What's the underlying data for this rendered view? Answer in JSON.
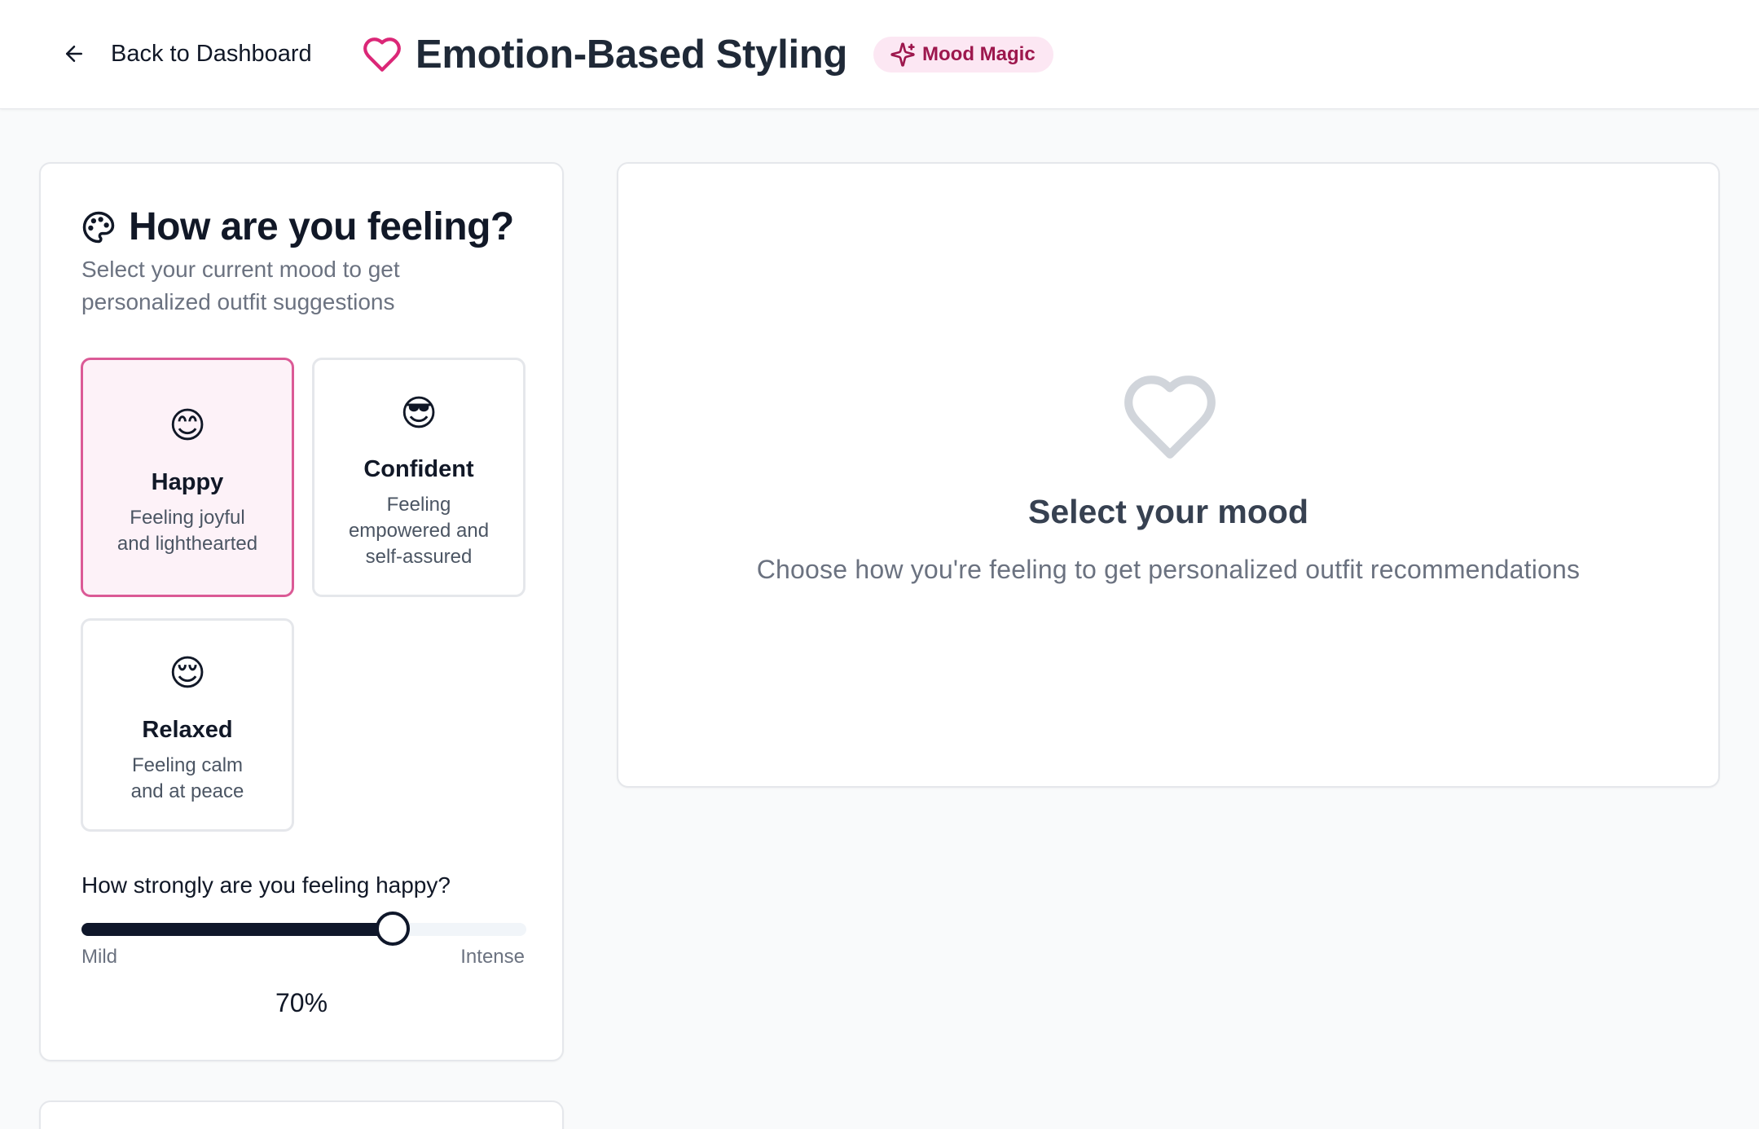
{
  "header": {
    "back_label": "Back to Dashboard",
    "title": "Emotion-Based Styling",
    "badge_label": "Mood Magic"
  },
  "mood_panel": {
    "title": "How are you feeling?",
    "subtitle": "Select your current mood to get personalized outfit suggestions",
    "moods": [
      {
        "emoji": "😊",
        "name": "Happy",
        "desc_line1": "Feeling joyful",
        "desc_line2": "and lighthearted",
        "selected": true
      },
      {
        "emoji": "😎",
        "name": "Confident",
        "desc_line1": "Feeling",
        "desc_line2": "empowered and",
        "desc_line3": "self-assured",
        "selected": false
      },
      {
        "emoji": "😌",
        "name": "Relaxed",
        "desc_line1": "Feeling calm",
        "desc_line2": "and at peace",
        "selected": false
      }
    ],
    "intensity": {
      "label": "How strongly are you feeling happy?",
      "min_label": "Mild",
      "max_label": "Intense",
      "value": 0.7,
      "value_label": "70%"
    }
  },
  "results_panel": {
    "icon": "heart-icon",
    "title": "Select your mood",
    "subtitle": "Choose how you're feeling to get personalized outfit recommendations"
  },
  "colors": {
    "accent": "#db2777",
    "selected_border": "#db5a96",
    "selected_bg": "#fdf2f8",
    "badge_bg": "#fce7f3",
    "badge_text": "#9d174d",
    "slider_fill": "#0f172a"
  }
}
